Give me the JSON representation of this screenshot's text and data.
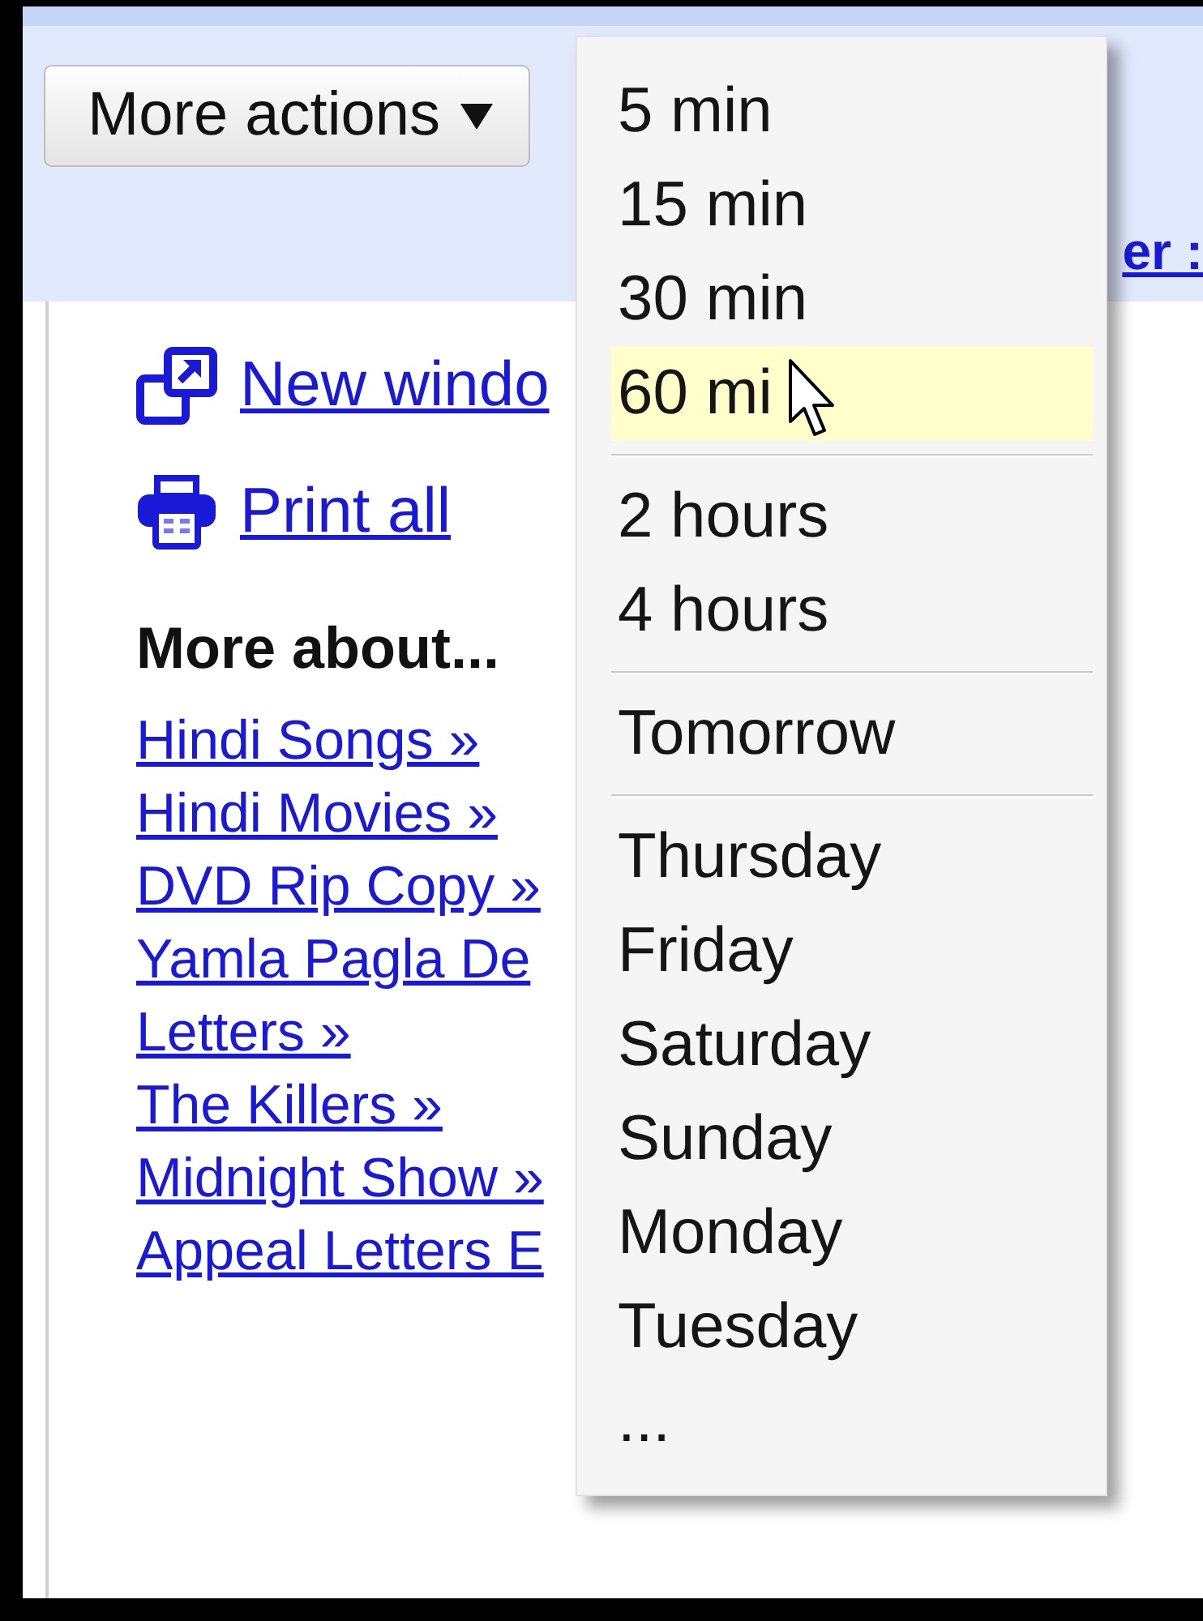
{
  "toolbar": {
    "more_actions_button": {
      "label": "More actions"
    },
    "link": "er :"
  },
  "sidebar": {
    "actions": [
      {
        "kind": "new-window",
        "label": "New windo"
      },
      {
        "kind": "print",
        "label": "Print all"
      }
    ],
    "more_about": {
      "heading": "More about...",
      "links": [
        "Hindi Songs »",
        "Hindi Movies »",
        "DVD Rip Copy »",
        "Yamla Pagla De",
        "Letters »",
        "The Killers »",
        "Midnight Show »",
        "Appeal Letters E"
      ]
    }
  },
  "dropdown_menu": {
    "groups": [
      {
        "items": [
          {
            "label": "5 min",
            "selected": false
          },
          {
            "label": "15 min",
            "selected": false
          },
          {
            "label": "30 min",
            "selected": false
          },
          {
            "label": "60 mi",
            "selected": true
          }
        ]
      },
      {
        "items": [
          {
            "label": "2 hours",
            "selected": false
          },
          {
            "label": "4 hours",
            "selected": false
          }
        ]
      },
      {
        "items": [
          {
            "label": "Tomorrow",
            "selected": false
          }
        ]
      },
      {
        "items": [
          {
            "label": "Thursday",
            "selected": false
          },
          {
            "label": "Friday",
            "selected": false
          },
          {
            "label": "Saturday",
            "selected": false
          },
          {
            "label": "Sunday",
            "selected": false
          },
          {
            "label": "Monday",
            "selected": false
          },
          {
            "label": "Tuesday",
            "selected": false
          },
          {
            "label": "...",
            "selected": false
          }
        ]
      }
    ]
  }
}
